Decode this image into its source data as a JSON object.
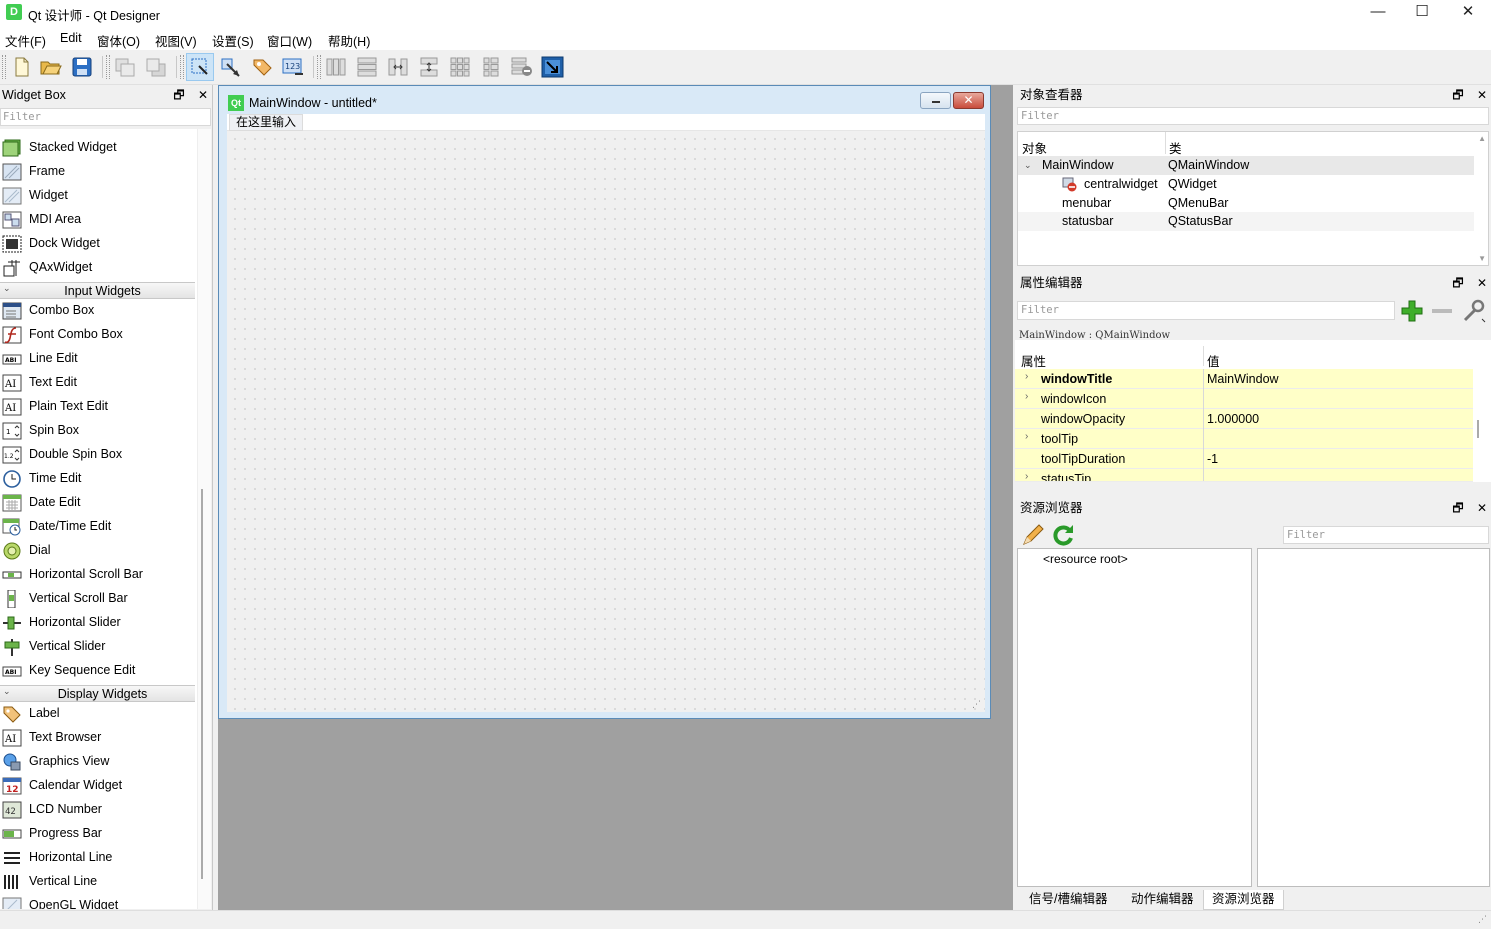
{
  "window": {
    "icon_letter": "D",
    "title": "Qt 设计师 - Qt Designer",
    "minimize": "—",
    "maximize": "☐",
    "close": "✕"
  },
  "menus": [
    "文件(F)",
    "Edit",
    "窗体(O)",
    "视图(V)",
    "设置(S)",
    "窗口(W)",
    "帮助(H)"
  ],
  "widget_box": {
    "title": "Widget Box",
    "float_icon": "🗗",
    "close_icon": "✕",
    "filter_placeholder": "Filter",
    "items_top": [
      "Stacked Widget",
      "Frame",
      "Widget",
      "MDI Area",
      "Dock Widget",
      "QAxWidget"
    ],
    "category_input": "Input Widgets",
    "items_input": [
      "Combo Box",
      "Font Combo Box",
      "Line Edit",
      "Text Edit",
      "Plain Text Edit",
      "Spin Box",
      "Double Spin Box",
      "Time Edit",
      "Date Edit",
      "Date/Time Edit",
      "Dial",
      "Horizontal Scroll Bar",
      "Vertical Scroll Bar",
      "Horizontal Slider",
      "Vertical Slider",
      "Key Sequence Edit"
    ],
    "category_display": "Display Widgets",
    "items_display": [
      "Label",
      "Text Browser",
      "Graphics View",
      "Calendar Widget",
      "LCD Number",
      "Progress Bar",
      "Horizontal Line",
      "Vertical Line",
      "OpenGL Widget"
    ]
  },
  "form": {
    "icon_label": "Qt",
    "title": "MainWindow - untitled*",
    "menu_placeholder": "在这里输入",
    "close": "✕"
  },
  "object_inspector": {
    "title": "对象查看器",
    "filter_placeholder": "Filter",
    "col_object": "对象",
    "col_class": "类",
    "rows": [
      {
        "object": "MainWindow",
        "class": "QMainWindow"
      },
      {
        "object": "centralwidget",
        "class": "QWidget"
      },
      {
        "object": "menubar",
        "class": "QMenuBar"
      },
      {
        "object": "statusbar",
        "class": "QStatusBar"
      }
    ]
  },
  "property_editor": {
    "title": "属性编辑器",
    "filter_placeholder": "Filter",
    "context": "MainWindow : QMainWindow",
    "col_property": "属性",
    "col_value": "值",
    "rows": [
      {
        "name": "windowTitle",
        "value": "MainWindow",
        "expandable": true,
        "bold": true
      },
      {
        "name": "windowIcon",
        "value": "",
        "expandable": true,
        "bold": false
      },
      {
        "name": "windowOpacity",
        "value": "1.000000",
        "expandable": false,
        "bold": false
      },
      {
        "name": "toolTip",
        "value": "",
        "expandable": true,
        "bold": false
      },
      {
        "name": "toolTipDuration",
        "value": "-1",
        "expandable": false,
        "bold": false
      },
      {
        "name": "statusTip",
        "value": "",
        "expandable": true,
        "bold": false
      }
    ]
  },
  "resource_browser": {
    "title": "资源浏览器",
    "filter_placeholder": "Filter",
    "root": "<resource root>"
  },
  "bottom_tabs": [
    "信号/槽编辑器",
    "动作编辑器",
    "资源浏览器"
  ],
  "colors": {
    "accent": "#41cd52",
    "property_highlight": "#ffffc8",
    "mdi_background": "#a0a0a0",
    "form_border": "#5a8bb7"
  }
}
